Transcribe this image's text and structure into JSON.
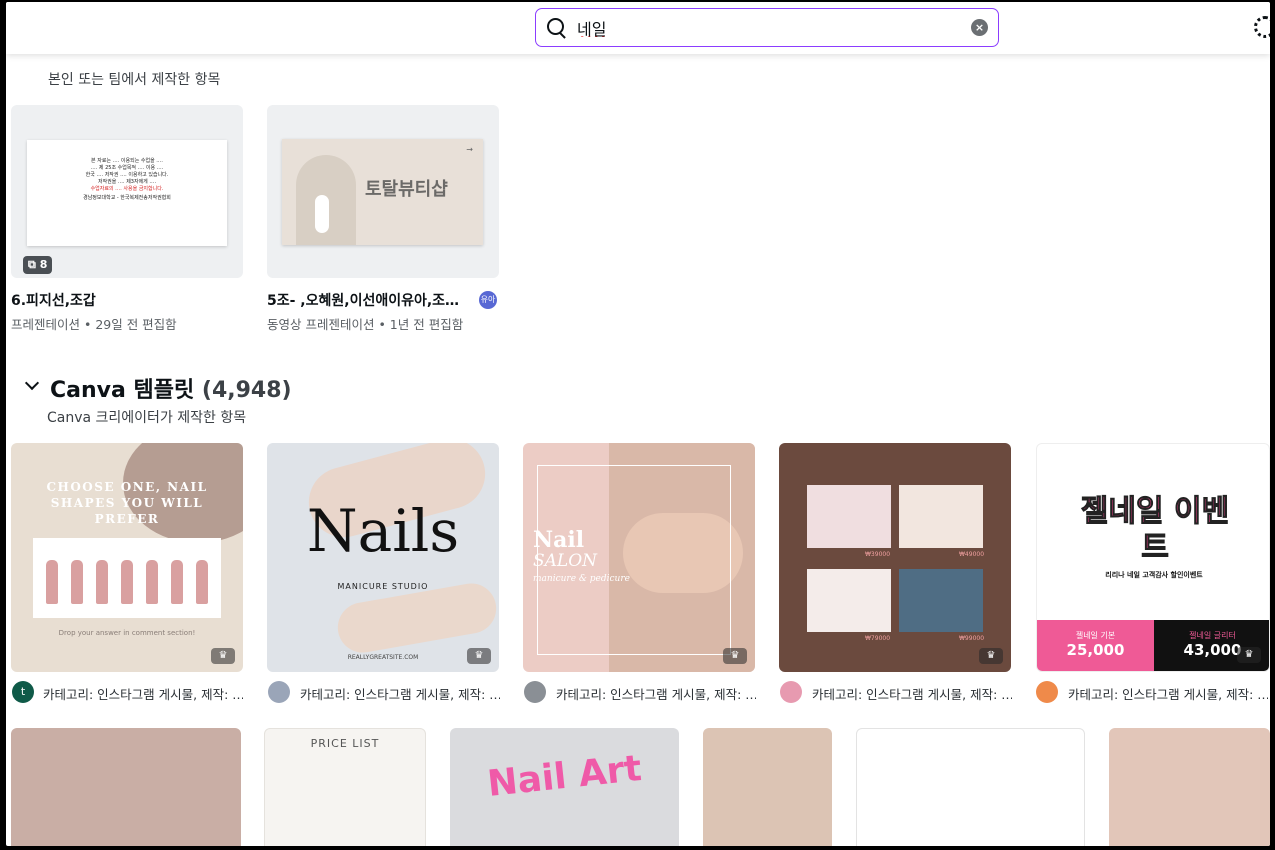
{
  "search": {
    "value": "네일"
  },
  "owned": {
    "subtitle": "본인 또는 팀에서 제작한 항목",
    "designs": [
      {
        "title": "6.피지선,조갑",
        "meta": "프레젠테이션 • 29일 전 편집함",
        "pages": "8",
        "thumb_lines": [
          "본 자료는 ‥‥ 이용되는 수업을 ‥‥",
          "‥‥ 제 25조 수업목적 ‥‥ 이용 ‥‥",
          "한국 ‥‥ 저작권 ‥‥ 이용하고 있습니다.",
          "저작권을 ‥‥ 제3자에게 ‥‥",
          "수업자료의 ‥‥ 사용을 금지합니다.",
          "경남정보대학교 - 한국복제전송저작권협회"
        ]
      },
      {
        "title": "5조- ,오혜원,이선애이유아,조…",
        "meta": "동영상 프레젠테이션 • 1년 전 편집함",
        "thumb_title": "토탈뷰티샵",
        "owner": "유아"
      }
    ]
  },
  "templates_section": {
    "title": "Canva 템플릿",
    "count": "(4,948)",
    "subtitle": "Canva 크리에이터가 제작한 항목",
    "items": [
      {
        "meta": "카테고리: 인스타그램 게시물, 제작: …",
        "avatar": "t",
        "thumb_text": "CHOOSE ONE, NAIL SHAPES YOU WILL PREFER",
        "thumb_sub": "Drop your answer in comment section!"
      },
      {
        "meta": "카테고리: 인스타그램 게시물, 제작: …",
        "thumb_text": "Nails",
        "thumb_sub": "MANICURE STUDIO",
        "thumb_sub2": "REALLYGREATSITE.COM"
      },
      {
        "meta": "카테고리: 인스타그램 게시물, 제작: …",
        "thumb_text": "Nail",
        "thumb_sub": "SALON",
        "thumb_sub2": "manicure & pedicure"
      },
      {
        "meta": "카테고리: 인스타그램 게시물, 제작: …",
        "prices": [
          "₩39000",
          "₩49000",
          "₩79000",
          "₩99000"
        ]
      },
      {
        "meta": "카테고리: 인스타그램 게시물, 제작: …",
        "thumb_text": "젤네일 이벤트",
        "thumb_sub": "리리나 네일 고객감사 할인이벤트",
        "price1_label": "젤네일 기본",
        "price1": "25,000",
        "price2_label": "젤네일 글리터",
        "price2": "43,000"
      }
    ],
    "row2": [
      {
        "label": ""
      },
      {
        "label": "PRICE LIST"
      },
      {
        "label": "Nail Art"
      },
      {
        "label": ""
      },
      {
        "label": ""
      },
      {
        "label": ""
      }
    ]
  },
  "colors": {
    "accent": "#8b3dff",
    "text": "#0d1216"
  }
}
